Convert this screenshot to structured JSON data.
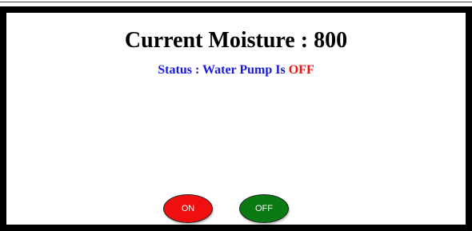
{
  "header": {
    "title": "Current Moisture : 800"
  },
  "status": {
    "label": "Status : Water Pump Is ",
    "state": "OFF"
  },
  "controls": {
    "on_label": "ON",
    "off_label": "OFF"
  },
  "colors": {
    "status_label": "#1a1ad6",
    "status_state": "#ee1111",
    "on_button": "#ef0f0f",
    "off_button": "#0a7a12",
    "frame_border": "#000000"
  }
}
